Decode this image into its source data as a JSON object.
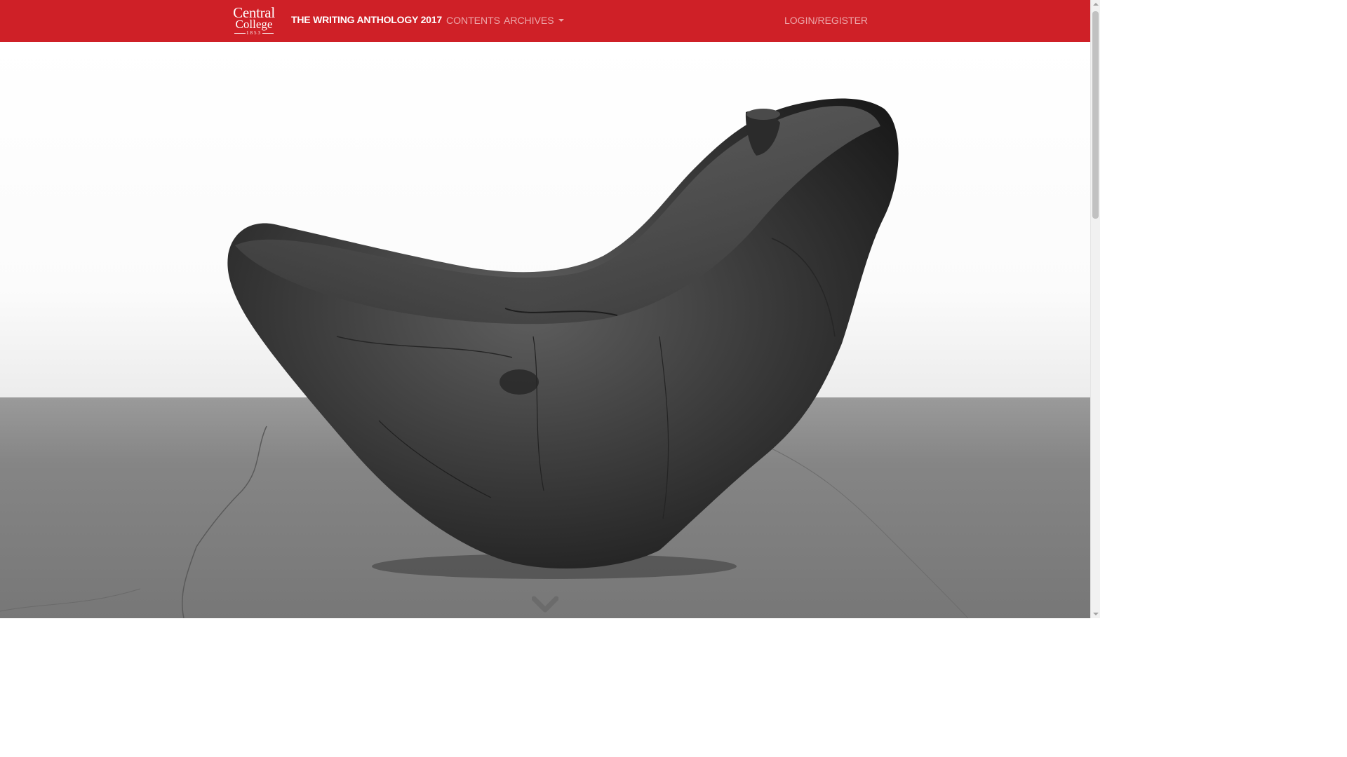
{
  "navbar": {
    "logo": {
      "line1": "Central",
      "line2": "College",
      "line3": "1853"
    },
    "title": "THE WRITING ANTHOLOGY 2017",
    "links": {
      "contents": "CONTENTS",
      "archives": "ARCHIVES",
      "login": "LOGIN/REGISTER"
    }
  },
  "hero": {
    "image_icon": "wooden-sculpture-photo",
    "scroll_icon": "chevron-down-icon"
  },
  "colors": {
    "navbar_bg": "#cf2027",
    "nav_text": "#ffffff"
  }
}
